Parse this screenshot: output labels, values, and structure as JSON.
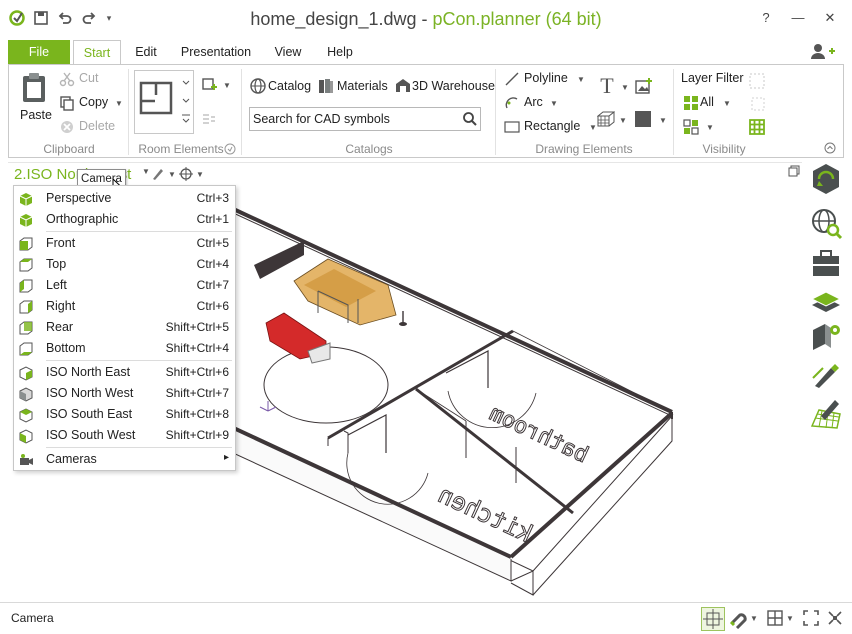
{
  "window": {
    "file_name": "home_design_1.dwg",
    "separator": " - ",
    "app_name": "pCon.planner (64 bit)",
    "help_label": "?",
    "minimize_label": "—",
    "close_label": "✕"
  },
  "tabs": {
    "file": "File",
    "start": "Start",
    "edit": "Edit",
    "presentation": "Presentation",
    "view": "View",
    "help": "Help"
  },
  "ribbon": {
    "clipboard": {
      "paste": "Paste",
      "cut": "Cut",
      "copy": "Copy",
      "delete": "Delete",
      "group_label": "Clipboard"
    },
    "room_elements": {
      "group_label": "Room Elements"
    },
    "catalogs": {
      "catalog": "Catalog",
      "materials": "Materials",
      "warehouse": "3D Warehouse",
      "search_placeholder": "Search for CAD symbols",
      "group_label": "Catalogs"
    },
    "drawing": {
      "polyline": "Polyline",
      "arc": "Arc",
      "rectangle": "Rectangle",
      "group_label": "Drawing Elements"
    },
    "visibility": {
      "layer_filter": "Layer Filter",
      "all": "All",
      "group_label": "Visibility"
    }
  },
  "viewport": {
    "view_name": "2.ISO North West",
    "tooltip": "Camera",
    "room_labels": {
      "kitchen": "kitchen",
      "bathroom": "bathroom"
    }
  },
  "camera_menu": {
    "items": [
      {
        "label": "Perspective",
        "shortcut": "Ctrl+3"
      },
      {
        "label": "Orthographic",
        "shortcut": "Ctrl+1"
      },
      {
        "label": "Front",
        "shortcut": "Ctrl+5"
      },
      {
        "label": "Top",
        "shortcut": "Ctrl+4"
      },
      {
        "label": "Left",
        "shortcut": "Ctrl+7"
      },
      {
        "label": "Right",
        "shortcut": "Ctrl+6"
      },
      {
        "label": "Rear",
        "shortcut": "Shift+Ctrl+5"
      },
      {
        "label": "Bottom",
        "shortcut": "Shift+Ctrl+4"
      },
      {
        "label": "ISO North East",
        "shortcut": "Shift+Ctrl+6"
      },
      {
        "label": "ISO North West",
        "shortcut": "Shift+Ctrl+7"
      },
      {
        "label": "ISO South East",
        "shortcut": "Shift+Ctrl+8"
      },
      {
        "label": "ISO South West",
        "shortcut": "Shift+Ctrl+9"
      },
      {
        "label": "Cameras",
        "submenu_arrow": "▸"
      }
    ]
  },
  "status": {
    "text": "Camera"
  },
  "colors": {
    "accent": "#7ab51d",
    "dark_icon": "#4a4f4f",
    "wall": "#3d3638"
  }
}
